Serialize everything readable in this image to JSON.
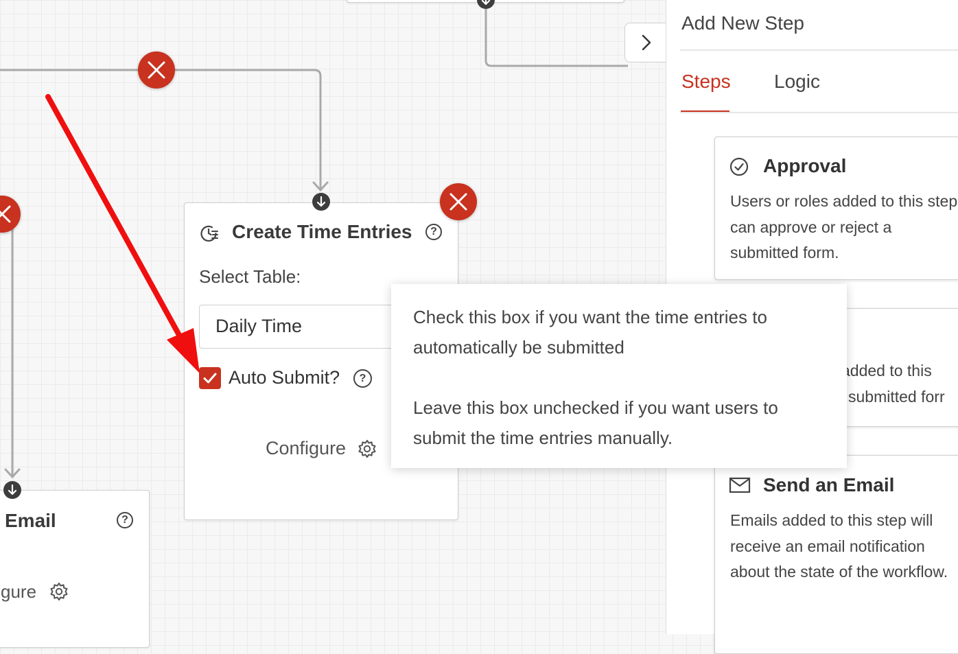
{
  "canvas": {
    "top_node_toggle_icon": "chevron-right-icon",
    "left_node": {
      "title": "Email",
      "configure_label": "gure",
      "help_icon": "question-circle-icon",
      "configure_icon": "gear-icon"
    },
    "time_node": {
      "title": "Create Time Entries",
      "title_icon": "clock-list-icon",
      "help_icon": "question-circle-icon",
      "select_label": "Select Table:",
      "select_value": "Daily Time",
      "auto_submit_label": "Auto Submit?",
      "auto_submit_checked": true,
      "configure_label": "Configure",
      "configure_icon": "gear-icon"
    },
    "tooltip": {
      "line1": "Check this box if you want the time entries to automatically be submitted",
      "line2": "Leave this box unchecked if you want users to submit the time entries manually."
    },
    "annotation_arrow_color": "#f00f0f",
    "delete_color": "#c8321f"
  },
  "panel": {
    "title": "Add New Step",
    "tabs": [
      {
        "label": "Steps",
        "active": true
      },
      {
        "label": "Logic",
        "active": false
      }
    ],
    "accent_color": "#c8321f",
    "steps": [
      {
        "icon": "check-circle-icon",
        "title": "Approval",
        "desc": "Users or roles added to this step can approve or reject a submitted form."
      },
      {
        "icon": "",
        "title": "",
        "desc_line1": "added to this",
        "desc_line2": "submitted forr"
      },
      {
        "icon": "envelope-icon",
        "title": "Send an Email",
        "desc": "Emails added to this step will receive an email notification about the state of the workflow."
      }
    ]
  }
}
